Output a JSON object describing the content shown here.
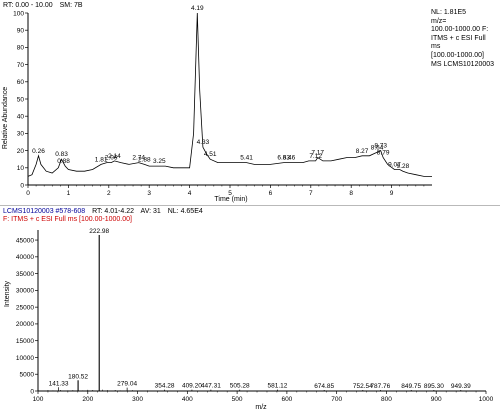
{
  "chromatogram": {
    "header": {
      "rt": "RT: 0.00 - 10.00",
      "sm": "SM: 7B"
    },
    "info": [
      "NL: 1.81E5",
      "m/z=",
      "100.00-1000.00 F:",
      "ITMS + c ESI Full",
      "ms",
      "[100.00-1000.00]",
      "MS LCMS10120003"
    ],
    "ylabel": "Relative Abundance",
    "xlabel": "Time (min)"
  },
  "spectrum": {
    "header": {
      "file": "LCMS10120003 #578-608",
      "rt": "RT: 4.01-4.22",
      "av": "AV: 31",
      "nl": "NL: 4.65E4"
    },
    "filter": "F: ITMS + c ESI Full ms [100.00-1000.00]",
    "ylabel": "Intensity",
    "xlabel": "m/z"
  },
  "colors": {
    "trace": "#000000",
    "header_red": "#cc0000",
    "header_blue": "#000099",
    "axis": "#000000"
  },
  "chart_data": [
    {
      "type": "line",
      "xlabel": "Time (min)",
      "ylabel": "Relative Abundance",
      "xlim": [
        0,
        10
      ],
      "ylim": [
        0,
        100
      ],
      "xticks": [
        "0",
        "1",
        "2",
        "3",
        "4",
        "5",
        "6",
        "7",
        "8",
        "9"
      ],
      "yticks": [
        "0",
        "10",
        "20",
        "30",
        "40",
        "50",
        "60",
        "70",
        "80",
        "90",
        "100"
      ],
      "series": [
        {
          "x": [
            0.0,
            0.1,
            0.2,
            0.26,
            0.32,
            0.45,
            0.6,
            0.75,
            0.83,
            0.92,
            1.0,
            1.2,
            1.4,
            1.6,
            1.81,
            1.95,
            2.06,
            2.14,
            2.3,
            2.5,
            2.74,
            2.88,
            3.0,
            3.1,
            3.25,
            3.4,
            3.6,
            3.8,
            4.0,
            4.1,
            4.19,
            4.25,
            4.33,
            4.42,
            4.51,
            4.7,
            4.9,
            5.1,
            5.41,
            5.6,
            5.8,
            6.0,
            6.33,
            6.46,
            6.6,
            6.8,
            6.95,
            7.12,
            7.17,
            7.3,
            7.5,
            7.7,
            7.9,
            8.1,
            8.27,
            8.45,
            8.64,
            8.73,
            8.79,
            8.9,
            9.07,
            9.2,
            9.28,
            9.4,
            9.6,
            9.8,
            10.0
          ],
          "y": [
            5,
            6,
            12,
            17,
            12,
            8,
            7,
            10,
            15,
            11,
            9,
            8,
            8,
            9,
            12,
            13,
            13,
            14,
            13,
            12,
            13,
            12,
            11,
            11,
            11,
            11,
            10,
            10,
            10,
            30,
            100,
            55,
            22,
            18,
            15,
            13,
            13,
            13,
            13,
            12,
            12,
            12,
            13,
            13,
            13,
            13,
            14,
            14,
            16,
            14,
            14,
            15,
            16,
            16,
            17,
            17,
            19,
            20,
            16,
            12,
            9,
            9,
            8,
            7,
            6,
            5,
            5
          ]
        }
      ],
      "annotations": [
        {
          "label": "0.26",
          "x": 0.26,
          "y": 17
        },
        {
          "label": "0.83",
          "x": 0.83,
          "y": 15
        },
        {
          "label": "0.88",
          "x": 0.88,
          "y": 11
        },
        {
          "label": "1.81",
          "x": 1.81,
          "y": 12
        },
        {
          "label": "2.06",
          "x": 2.06,
          "y": 13
        },
        {
          "label": "2.14",
          "x": 2.14,
          "y": 14
        },
        {
          "label": "2.74",
          "x": 2.74,
          "y": 13
        },
        {
          "label": "2.88",
          "x": 2.88,
          "y": 12
        },
        {
          "label": "3.25",
          "x": 3.25,
          "y": 11
        },
        {
          "label": "4.19",
          "x": 4.19,
          "y": 100
        },
        {
          "label": "4.33",
          "x": 4.33,
          "y": 22
        },
        {
          "label": "4.51",
          "x": 4.51,
          "y": 15
        },
        {
          "label": "5.41",
          "x": 5.41,
          "y": 13
        },
        {
          "label": "6.33",
          "x": 6.33,
          "y": 13
        },
        {
          "label": "6.46",
          "x": 6.46,
          "y": 13
        },
        {
          "label": "7.12",
          "x": 7.12,
          "y": 14
        },
        {
          "label": "7.17",
          "x": 7.17,
          "y": 16
        },
        {
          "label": "8.27",
          "x": 8.27,
          "y": 17
        },
        {
          "label": "8.64",
          "x": 8.64,
          "y": 19
        },
        {
          "label": "8.73",
          "x": 8.73,
          "y": 20
        },
        {
          "label": "8.79",
          "x": 8.79,
          "y": 16
        },
        {
          "label": "9.07",
          "x": 9.07,
          "y": 9
        },
        {
          "label": "9.28",
          "x": 9.28,
          "y": 8
        }
      ]
    },
    {
      "type": "bar",
      "xlabel": "m/z",
      "ylabel": "Intensity",
      "xlim": [
        100,
        1000
      ],
      "ylim": [
        0,
        48000
      ],
      "xticks": [
        "100",
        "200",
        "300",
        "400",
        "500",
        "600",
        "700",
        "800",
        "900",
        "1000"
      ],
      "yticks": [
        "0",
        "5000",
        "10000",
        "15000",
        "20000",
        "25000",
        "30000",
        "35000",
        "40000",
        "45000"
      ],
      "peaks": [
        {
          "mz": 141.33,
          "intensity": 1100,
          "label": "141.33"
        },
        {
          "mz": 180.52,
          "intensity": 3200,
          "label": "180.52"
        },
        {
          "mz": 222.98,
          "intensity": 46500,
          "label": "222.98"
        },
        {
          "mz": 279.04,
          "intensity": 1000,
          "label": "279.04"
        },
        {
          "mz": 354.28,
          "intensity": 400,
          "label": "354.28"
        },
        {
          "mz": 409.2,
          "intensity": 400,
          "label": "409.20"
        },
        {
          "mz": 447.31,
          "intensity": 400,
          "label": "447.31"
        },
        {
          "mz": 505.28,
          "intensity": 400,
          "label": "505.28"
        },
        {
          "mz": 581.12,
          "intensity": 400,
          "label": "581.12"
        },
        {
          "mz": 674.85,
          "intensity": 300,
          "label": "674.85"
        },
        {
          "mz": 752.54,
          "intensity": 300,
          "label": "752.54"
        },
        {
          "mz": 787.76,
          "intensity": 300,
          "label": "787.76"
        },
        {
          "mz": 849.75,
          "intensity": 300,
          "label": "849.75"
        },
        {
          "mz": 895.3,
          "intensity": 300,
          "label": "895.30"
        },
        {
          "mz": 949.39,
          "intensity": 300,
          "label": "949.39"
        }
      ],
      "noise": [
        [
          110,
          150
        ],
        [
          120,
          250
        ],
        [
          130,
          200
        ],
        [
          145,
          300
        ],
        [
          160,
          200
        ],
        [
          170,
          250
        ],
        [
          190,
          200
        ],
        [
          200,
          350
        ],
        [
          210,
          300
        ],
        [
          230,
          400
        ],
        [
          240,
          250
        ],
        [
          255,
          300
        ],
        [
          265,
          200
        ],
        [
          290,
          250
        ],
        [
          300,
          150
        ],
        [
          320,
          200
        ],
        [
          340,
          150
        ],
        [
          370,
          150
        ],
        [
          390,
          120
        ],
        [
          420,
          150
        ],
        [
          460,
          120
        ],
        [
          480,
          120
        ],
        [
          520,
          100
        ],
        [
          550,
          120
        ],
        [
          610,
          100
        ],
        [
          640,
          100
        ],
        [
          700,
          90
        ],
        [
          730,
          90
        ],
        [
          770,
          90
        ],
        [
          820,
          90
        ],
        [
          870,
          80
        ],
        [
          920,
          80
        ],
        [
          970,
          80
        ]
      ]
    }
  ]
}
